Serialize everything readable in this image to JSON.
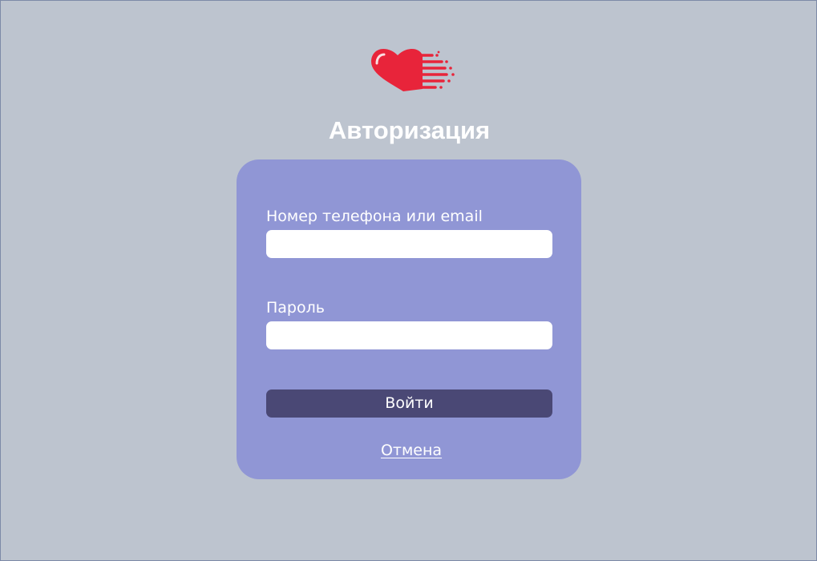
{
  "page": {
    "title": "Авторизация"
  },
  "logo": {
    "icon": "heart-speed-icon",
    "color": "#e8243a"
  },
  "form": {
    "login_label": "Номер телефона или email",
    "login_value": "",
    "password_label": "Пароль",
    "password_value": "",
    "submit_label": "Войти",
    "cancel_label": "Отмена"
  },
  "colors": {
    "background": "#bdc4cf",
    "card": "#9096d5",
    "button": "#4a4875",
    "text": "#ffffff"
  }
}
